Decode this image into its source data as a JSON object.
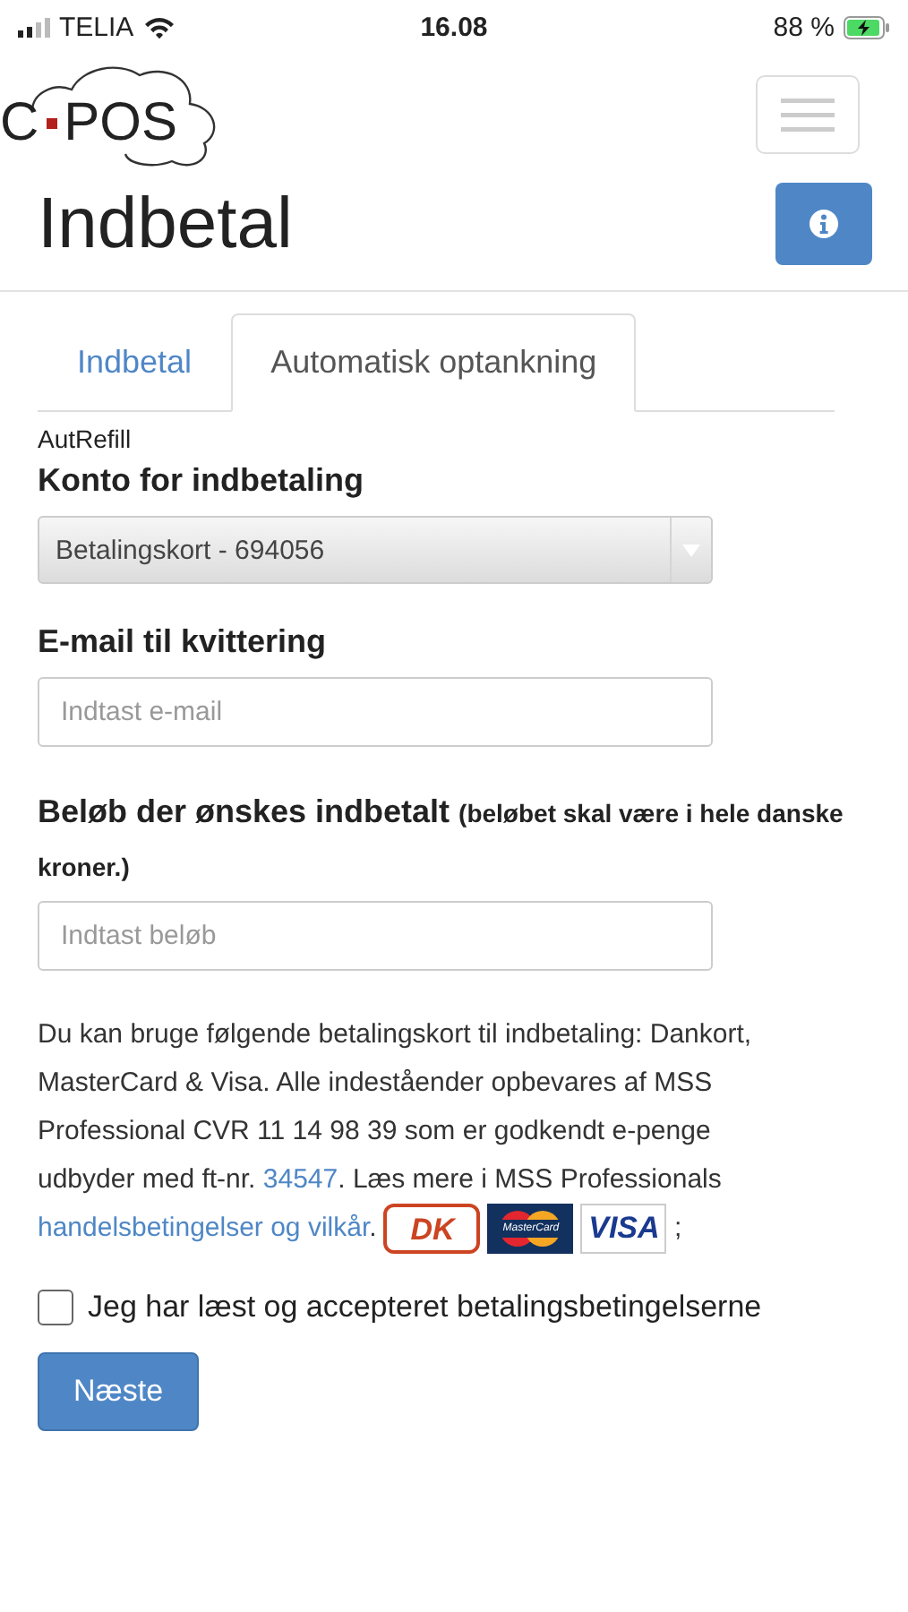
{
  "status_bar": {
    "carrier": "TELIA",
    "time": "16.08",
    "battery": "88 %",
    "charging": true
  },
  "logo": {
    "left": "C",
    "right": "POS"
  },
  "page_title": "Indbetal",
  "tabs": [
    {
      "label": "Indbetal",
      "selected": false
    },
    {
      "label": "Automatisk optankning",
      "selected": true
    }
  ],
  "section_caption": "AutRefill",
  "account": {
    "label": "Konto for indbetaling",
    "value": "Betalingskort - 694056"
  },
  "email": {
    "label": "E-mail til kvittering",
    "placeholder": "Indtast e-mail"
  },
  "amount": {
    "label": "Beløb der ønskes indbetalt",
    "note": "(beløbet skal være i hele danske kroner.)",
    "placeholder": "Indtast beløb"
  },
  "info_parts": [
    {
      "kind": "text",
      "text": "Du kan bruge følgende betalingskort til indbetaling: Dankort, MasterCard & Visa. Alle indeståender opbevares af MSS Professional CVR 11 14 98 39 som er godkendt e-penge udbyder med ft-nr. "
    },
    {
      "kind": "link",
      "text": "34547"
    },
    {
      "kind": "text",
      "text": ". Læs mere i MSS Professionals "
    },
    {
      "kind": "link",
      "text": "handelsbetingelser og vilkår"
    },
    {
      "kind": "text",
      "text": ". "
    },
    {
      "kind": "dankort",
      "text": "DK"
    },
    {
      "kind": "mastercard",
      "text": "MasterCard"
    },
    {
      "kind": "visa",
      "text": "VISA"
    },
    {
      "kind": "text",
      "text": ";"
    }
  ],
  "accept": {
    "label": "Jeg har læst og accepteret betalingsbetingelserne",
    "checked": false
  },
  "next_button": "Næste"
}
